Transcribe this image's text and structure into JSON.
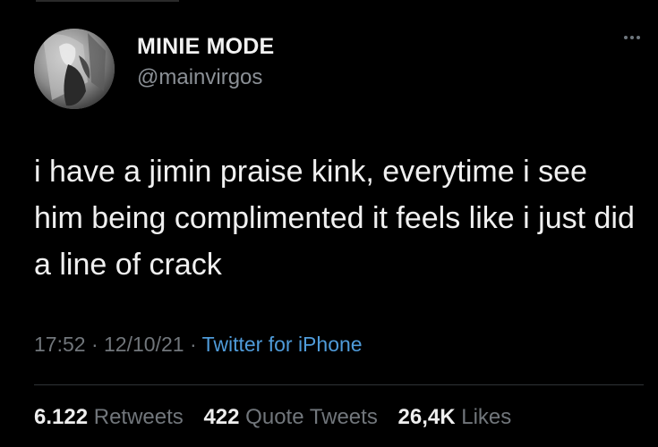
{
  "author": {
    "display_name": "MINIE MODE",
    "handle": "@mainvirgos",
    "avatar_icon": "avatar-image"
  },
  "tweet": {
    "text": "i have a jimin praise kink, everytime i see him being complimented it feels like i just did a line of crack",
    "time": "17:52",
    "date": "12/10/21",
    "separator": "·",
    "source": "Twitter for iPhone"
  },
  "stats": {
    "retweets_count": "6.122",
    "retweets_label": "Retweets",
    "quote_count": "422",
    "quote_label": "Quote Tweets",
    "likes_count": "26,4K",
    "likes_label": "Likes"
  },
  "colors": {
    "background": "#000000",
    "link": "#4f9bd9",
    "secondary_text": "#71767b"
  }
}
